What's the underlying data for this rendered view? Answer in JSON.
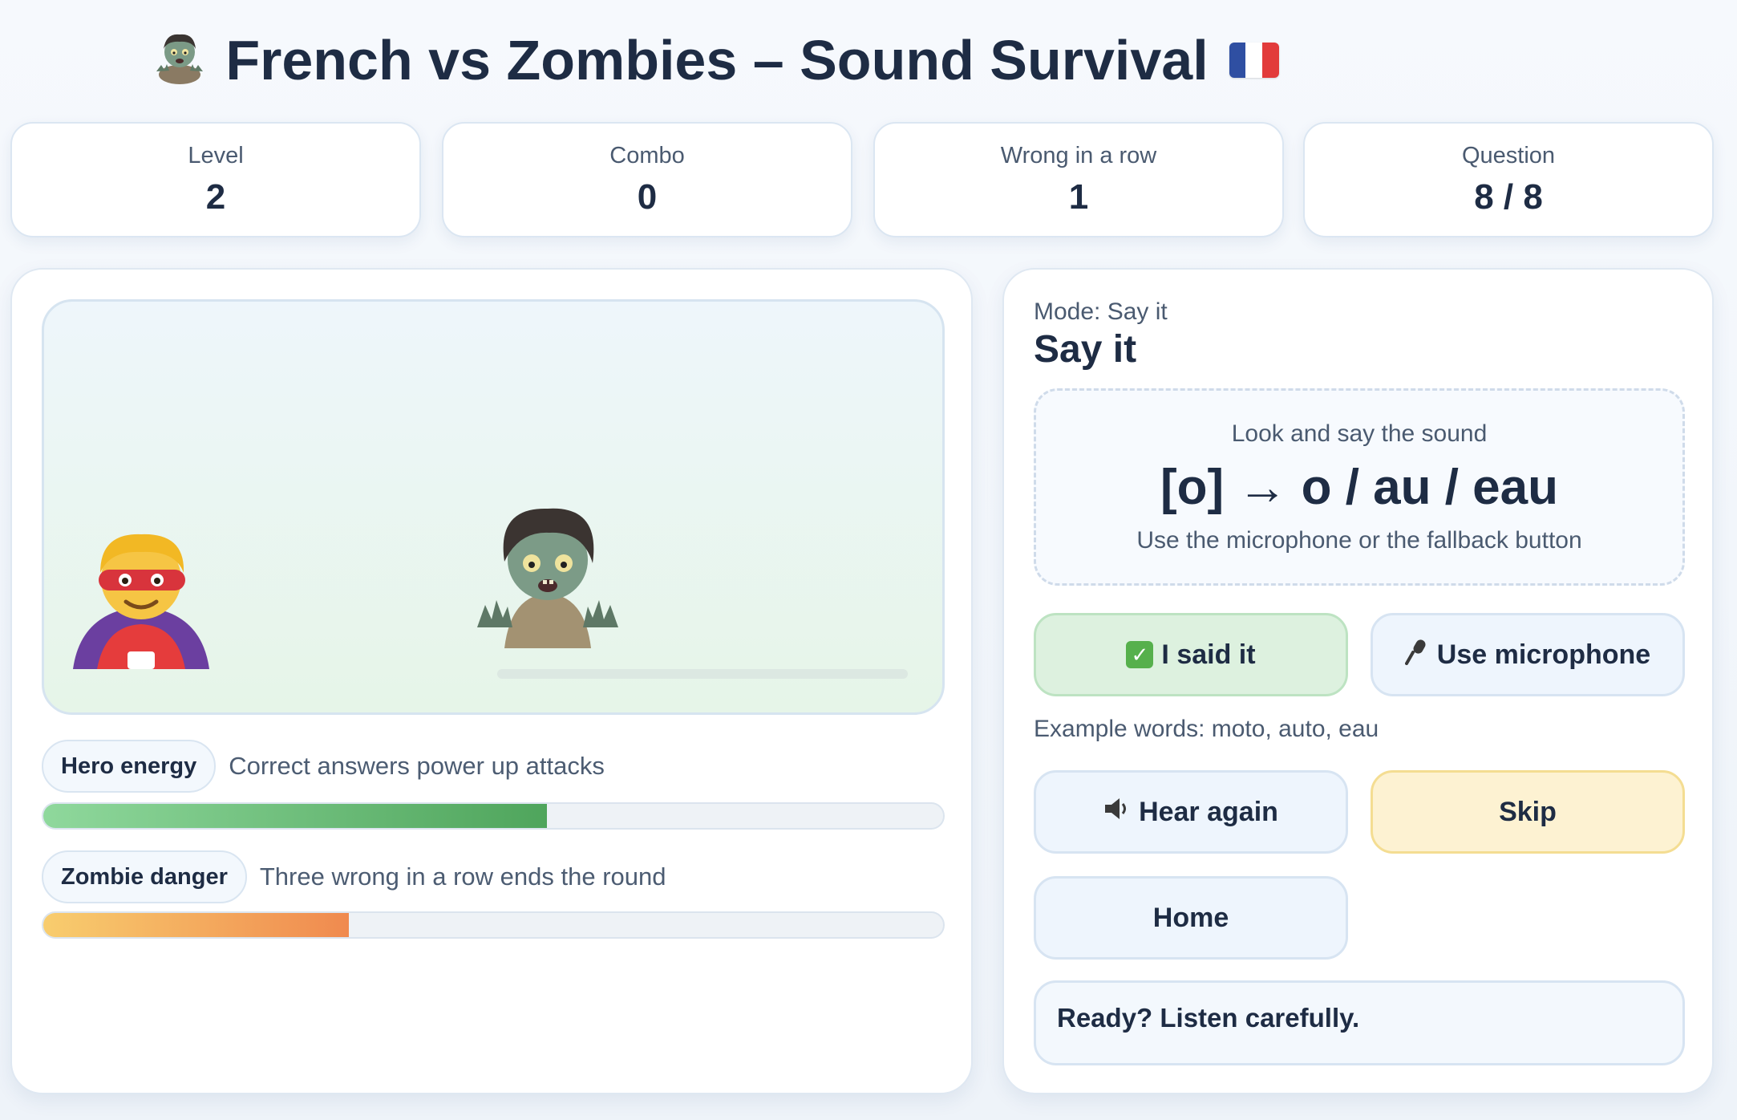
{
  "app": {
    "title": "French vs Zombies – Sound Survival",
    "title_icon": "zombie-icon",
    "flag_icon": "french-flag-icon",
    "colors": {
      "flag_blue": "#2f4fa2",
      "flag_white": "#ffffff",
      "flag_red": "#e23b3b"
    }
  },
  "stats": [
    {
      "label": "Level",
      "value": "2"
    },
    {
      "label": "Combo",
      "value": "0"
    },
    {
      "label": "Wrong in a row",
      "value": "1"
    },
    {
      "label": "Question",
      "value": "8 / 8"
    }
  ],
  "arena": {
    "hero_icon": "superhero-icon",
    "zombie_icon": "zombie-icon"
  },
  "meters": {
    "hero": {
      "label": "Hero energy",
      "description": "Correct answers power up attacks",
      "level": 0.56,
      "color": "#5aad65"
    },
    "zombie": {
      "label": "Zombie danger",
      "description": "Three wrong in a row ends the round",
      "level": 0.34,
      "color": "#f0914f"
    }
  },
  "panel": {
    "mode_label": "Mode: Say it",
    "mode_title": "Say it",
    "prompt": {
      "instruction": "Look and say the sound",
      "sound": "[o] → o / au / eau",
      "hint": "Use the microphone or the fallback button"
    },
    "buttons": {
      "said_it": "I said it",
      "said_it_icon": "check-mark-icon",
      "microphone": "Use microphone",
      "microphone_icon": "microphone-icon",
      "hear_again": "Hear again",
      "hear_again_icon": "speaker-icon",
      "skip": "Skip",
      "home": "Home"
    },
    "examples": "Example words: moto, auto, eau",
    "status": "Ready? Listen carefully."
  }
}
